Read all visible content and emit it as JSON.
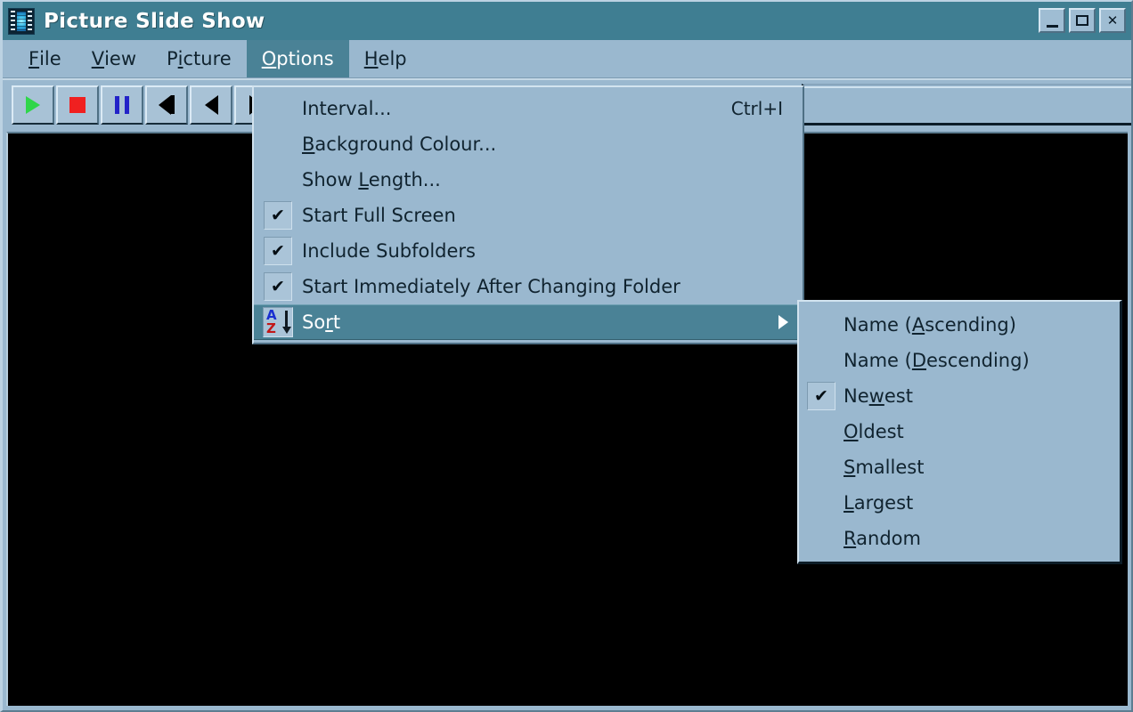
{
  "window": {
    "title": "Picture Slide Show",
    "icon": "film-strip-icon",
    "colors": {
      "titlebar": "#3f7e92",
      "face": "#9ab8cf",
      "highlight": "#4a8296",
      "display": "#000000"
    },
    "controls": {
      "minimize": "_",
      "maximize": "□",
      "close": "✕"
    }
  },
  "menubar": {
    "items": [
      {
        "label": "File",
        "mnemonic": "F",
        "active": false
      },
      {
        "label": "View",
        "mnemonic": "V",
        "active": false
      },
      {
        "label": "Picture",
        "mnemonic": "P",
        "active": false
      },
      {
        "label": "Options",
        "mnemonic": "O",
        "active": true
      },
      {
        "label": "Help",
        "mnemonic": "H",
        "active": false
      }
    ]
  },
  "toolbar": {
    "buttons": [
      {
        "name": "play-button",
        "icon": "play-icon",
        "color": "#2fd64a"
      },
      {
        "name": "stop-button",
        "icon": "stop-icon",
        "color": "#f02020"
      },
      {
        "name": "pause-button",
        "icon": "pause-icon",
        "color": "#2323c8"
      },
      {
        "name": "first-button",
        "icon": "skip-start-icon",
        "color": "#000000"
      },
      {
        "name": "previous-button",
        "icon": "previous-icon",
        "color": "#000000"
      },
      {
        "name": "next-button",
        "icon": "next-icon",
        "color": "#000000"
      }
    ],
    "field_value": ""
  },
  "options_menu": {
    "items": [
      {
        "label": "Interval...",
        "pre": "Interval...",
        "mnemonic": "",
        "post": "",
        "accel": "Ctrl+I",
        "checked": false,
        "submenu": false,
        "selected": false
      },
      {
        "label": "Background Colour...",
        "pre": "",
        "mnemonic": "B",
        "post": "ackground Colour...",
        "accel": "",
        "checked": false,
        "submenu": false,
        "selected": false
      },
      {
        "label": "Show Length...",
        "pre": "Show ",
        "mnemonic": "L",
        "post": "ength...",
        "accel": "",
        "checked": false,
        "submenu": false,
        "selected": false
      },
      {
        "label": "Start Full Screen",
        "pre": "Start Full Screen",
        "mnemonic": "",
        "post": "",
        "accel": "",
        "checked": true,
        "submenu": false,
        "selected": false
      },
      {
        "label": "Include Subfolders",
        "pre": "Include Subfolders",
        "mnemonic": "",
        "post": "",
        "accel": "",
        "checked": true,
        "submenu": false,
        "selected": false
      },
      {
        "label": "Start Immediately After Changing Folder",
        "pre": "Start Immediately After Changing Folder",
        "mnemonic": "",
        "post": "",
        "accel": "",
        "checked": true,
        "submenu": false,
        "selected": false
      },
      {
        "label": "Sort",
        "pre": "So",
        "mnemonic": "r",
        "post": "t",
        "accel": "",
        "checked": false,
        "submenu": true,
        "selected": true,
        "icon": "sort-az-icon"
      }
    ]
  },
  "sort_submenu": {
    "items": [
      {
        "label": "Name (Ascending)",
        "pre": "Name (",
        "mnemonic": "A",
        "post": "scending)",
        "checked": false
      },
      {
        "label": "Name (Descending)",
        "pre": "Name (",
        "mnemonic": "D",
        "post": "escending)",
        "checked": false
      },
      {
        "label": "Newest",
        "pre": "Ne",
        "mnemonic": "w",
        "post": "est",
        "checked": true
      },
      {
        "label": "Oldest",
        "pre": "",
        "mnemonic": "O",
        "post": "ldest",
        "checked": false
      },
      {
        "label": "Smallest",
        "pre": "",
        "mnemonic": "S",
        "post": "mallest",
        "checked": false
      },
      {
        "label": "Largest",
        "pre": "",
        "mnemonic": "L",
        "post": "argest",
        "checked": false
      },
      {
        "label": "Random",
        "pre": "",
        "mnemonic": "R",
        "post": "andom",
        "checked": false
      }
    ],
    "checkmark": "✔"
  }
}
